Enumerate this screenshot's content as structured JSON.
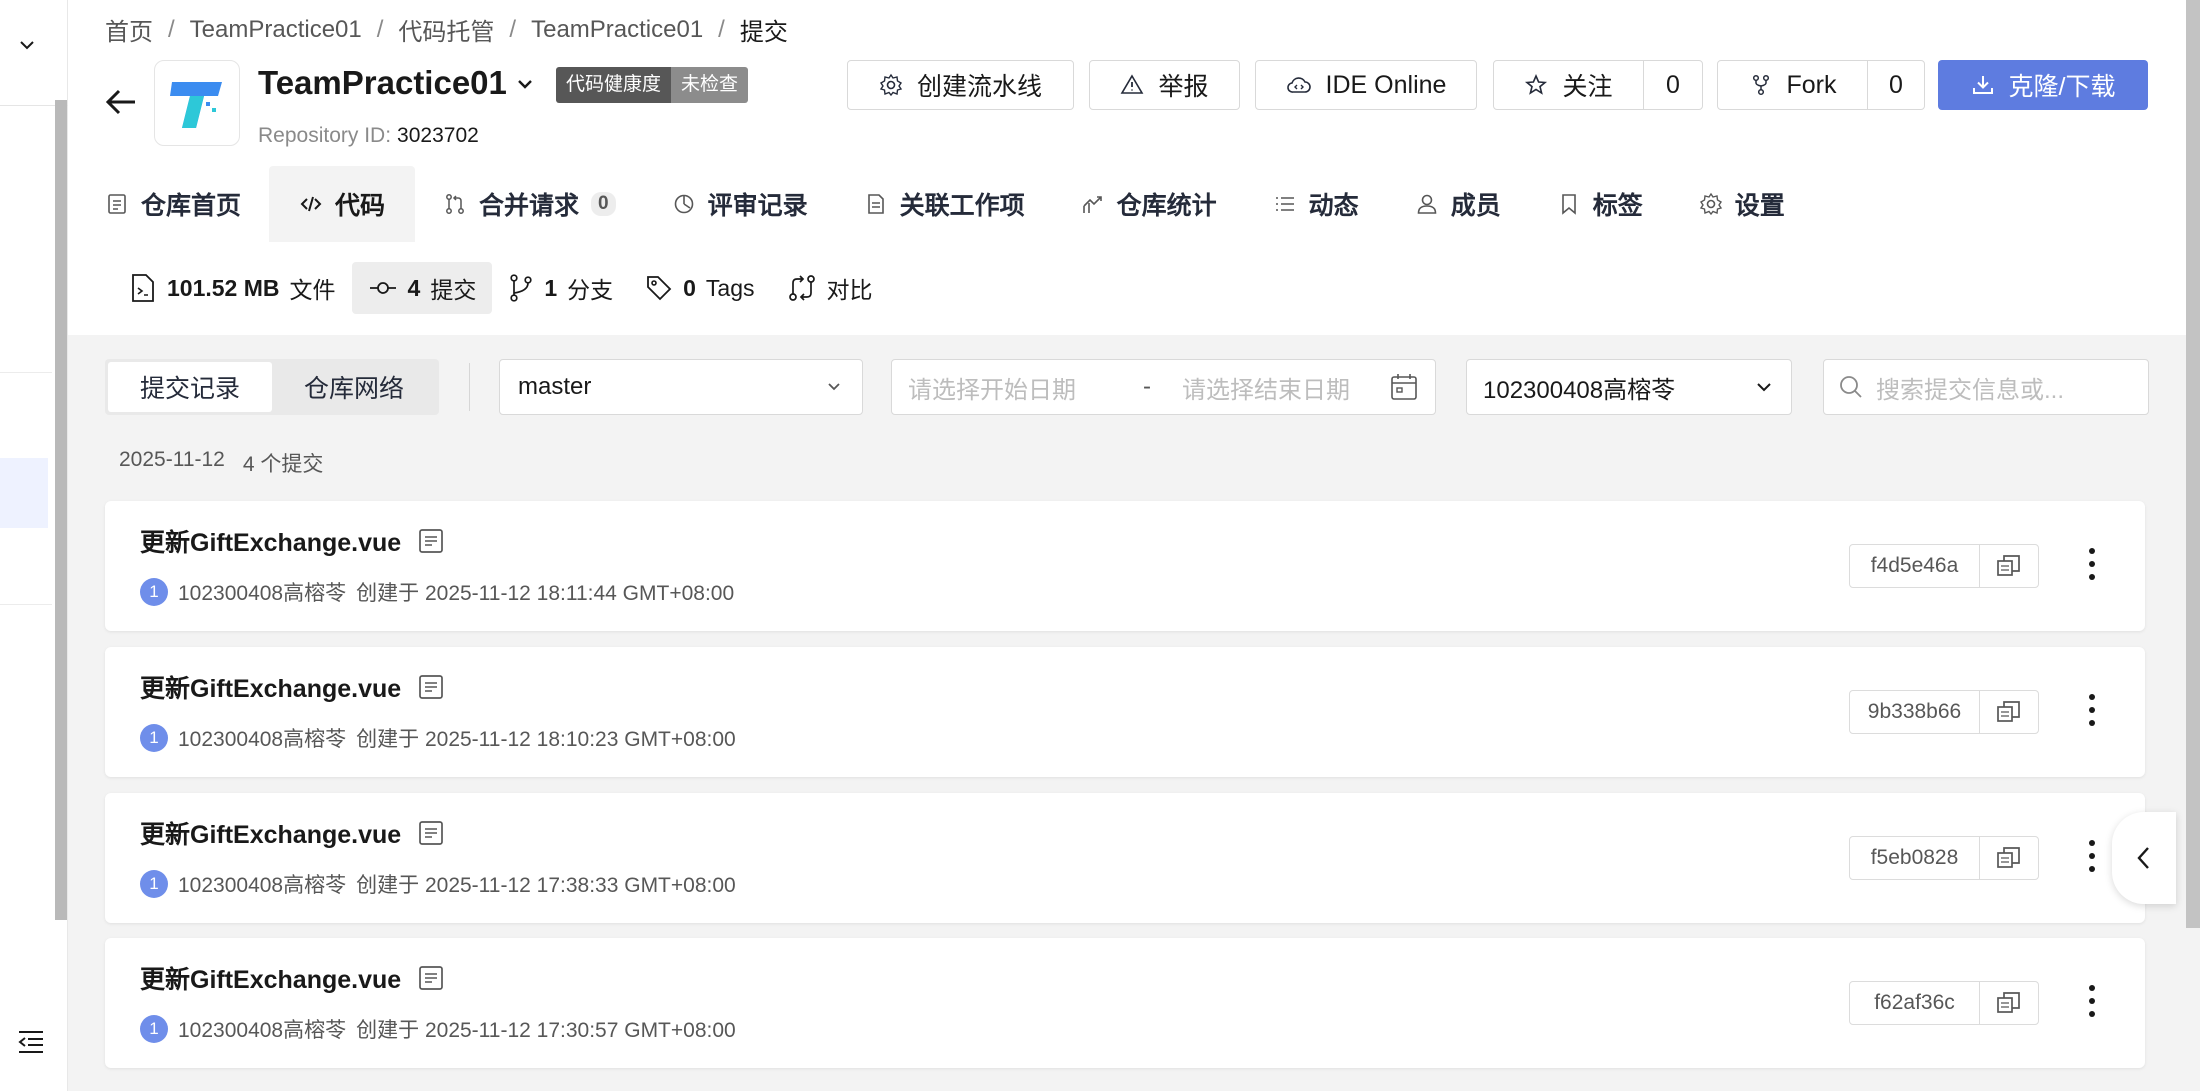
{
  "breadcrumb": [
    "首页",
    "TeamPractice01",
    "代码托管",
    "TeamPractice01",
    "提交"
  ],
  "repo": {
    "name": "TeamPractice01",
    "health_label": "代码健康度",
    "health_status": "未检查",
    "id_label": "Repository ID:",
    "id_value": "3023702"
  },
  "actions": {
    "pipeline": "创建流水线",
    "report": "举报",
    "ide": "IDE Online",
    "watch": "关注",
    "watch_count": "0",
    "fork": "Fork",
    "fork_count": "0",
    "clone": "克隆/下载"
  },
  "tabs": [
    {
      "label": "仓库首页",
      "icon": "file-icon"
    },
    {
      "label": "代码",
      "icon": "code-icon"
    },
    {
      "label": "合并请求",
      "icon": "merge-request-icon",
      "count": "0"
    },
    {
      "label": "评审记录",
      "icon": "review-icon"
    },
    {
      "label": "关联工作项",
      "icon": "document-icon"
    },
    {
      "label": "仓库统计",
      "icon": "chart-icon"
    },
    {
      "label": "动态",
      "icon": "list-icon"
    },
    {
      "label": "成员",
      "icon": "user-icon"
    },
    {
      "label": "标签",
      "icon": "bookmark-icon"
    },
    {
      "label": "设置",
      "icon": "gear-icon"
    }
  ],
  "stats": {
    "size_value": "101.52 MB",
    "size_label": "文件",
    "commits_value": "4",
    "commits_label": "提交",
    "branches_value": "1",
    "branches_label": "分支",
    "tags_value": "0",
    "tags_label": "Tags",
    "compare_label": "对比"
  },
  "filters": {
    "seg_commits": "提交记录",
    "seg_network": "仓库网络",
    "branch": "master",
    "start_placeholder": "请选择开始日期",
    "range_sep": "-",
    "end_placeholder": "请选择结束日期",
    "author": "102300408高榕苓",
    "search_placeholder": "搜索提交信息或..."
  },
  "group": {
    "date": "2025-11-12",
    "count_text": "4 个提交"
  },
  "commits": [
    {
      "title": "更新GiftExchange.vue",
      "avatar": "1",
      "author": "102300408高榕苓",
      "created": "创建于 2025-11-12 18:11:44 GMT+08:00",
      "hash": "f4d5e46a"
    },
    {
      "title": "更新GiftExchange.vue",
      "avatar": "1",
      "author": "102300408高榕苓",
      "created": "创建于 2025-11-12 18:10:23 GMT+08:00",
      "hash": "9b338b66"
    },
    {
      "title": "更新GiftExchange.vue",
      "avatar": "1",
      "author": "102300408高榕苓",
      "created": "创建于 2025-11-12 17:38:33 GMT+08:00",
      "hash": "f5eb0828"
    },
    {
      "title": "更新GiftExchange.vue",
      "avatar": "1",
      "author": "102300408高榕苓",
      "created": "创建于 2025-11-12 17:30:57 GMT+08:00",
      "hash": "f62af36c"
    }
  ],
  "colors": {
    "primary": "#5e7ce0",
    "avatar": "#6f8eea",
    "content_bg": "#f3f3f3"
  }
}
